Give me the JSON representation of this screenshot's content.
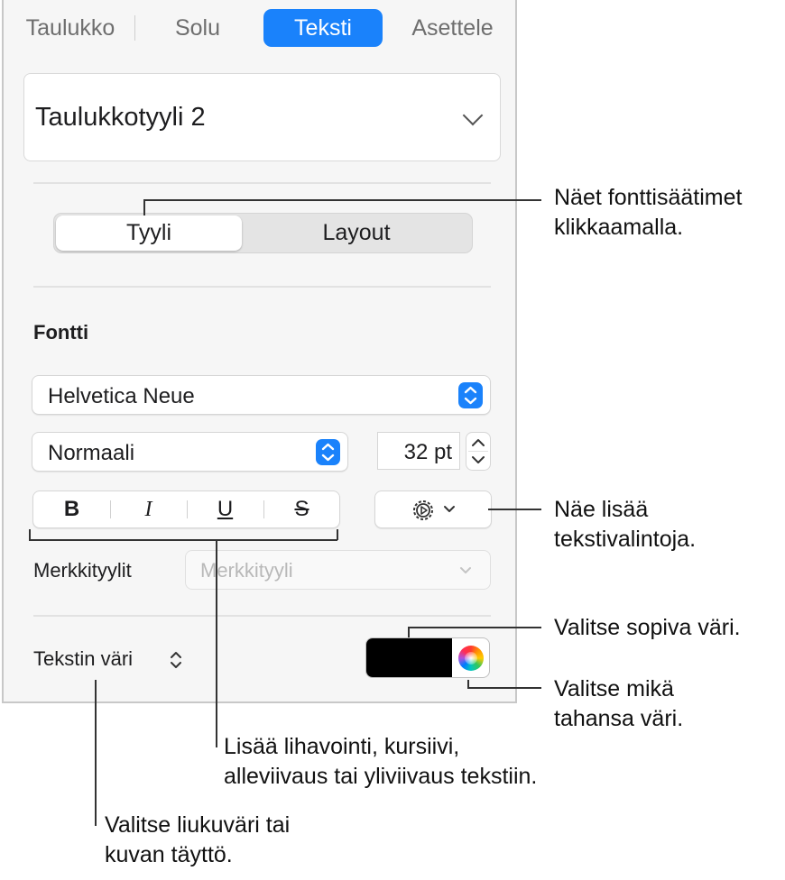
{
  "tabs": [
    {
      "label": "Taulukko"
    },
    {
      "label": "Solu"
    },
    {
      "label": "Teksti",
      "active": true
    },
    {
      "label": "Asettele"
    }
  ],
  "style_selector": {
    "value": "Taulukkotyyli 2"
  },
  "segmented": {
    "tyyli": "Tyyli",
    "layout": "Layout",
    "selected": "Tyyli"
  },
  "font": {
    "section_label": "Fontti",
    "family": "Helvetica Neue",
    "weight": "Normaali",
    "size": "32 pt"
  },
  "format_buttons": {
    "bold": "B",
    "italic": "I",
    "underline": "U",
    "strikethrough": "S"
  },
  "character_styles": {
    "label": "Merkkityylit",
    "placeholder": "Merkkityyli"
  },
  "text_color": {
    "label": "Tekstin väri",
    "swatch_color": "#000000"
  },
  "callouts": {
    "font_controls_1": "Näet fonttisäätimet",
    "font_controls_2": "klikkaamalla.",
    "more_options_1": "Näe lisää",
    "more_options_2": "tekstivalintoja.",
    "pick_color": "Valitse sopiva väri.",
    "any_color_1": "Valitse mikä",
    "any_color_2": "tahansa väri.",
    "format_1": "Lisää lihavointi, kursiivi,",
    "format_2": "alleviivaus tai yliviivaus tekstiin.",
    "gradient_1": "Valitse liukuväri tai",
    "gradient_2": "kuvan täyttö."
  },
  "colors": {
    "accent": "#1a82fb",
    "panel": "#f6f6f6"
  }
}
